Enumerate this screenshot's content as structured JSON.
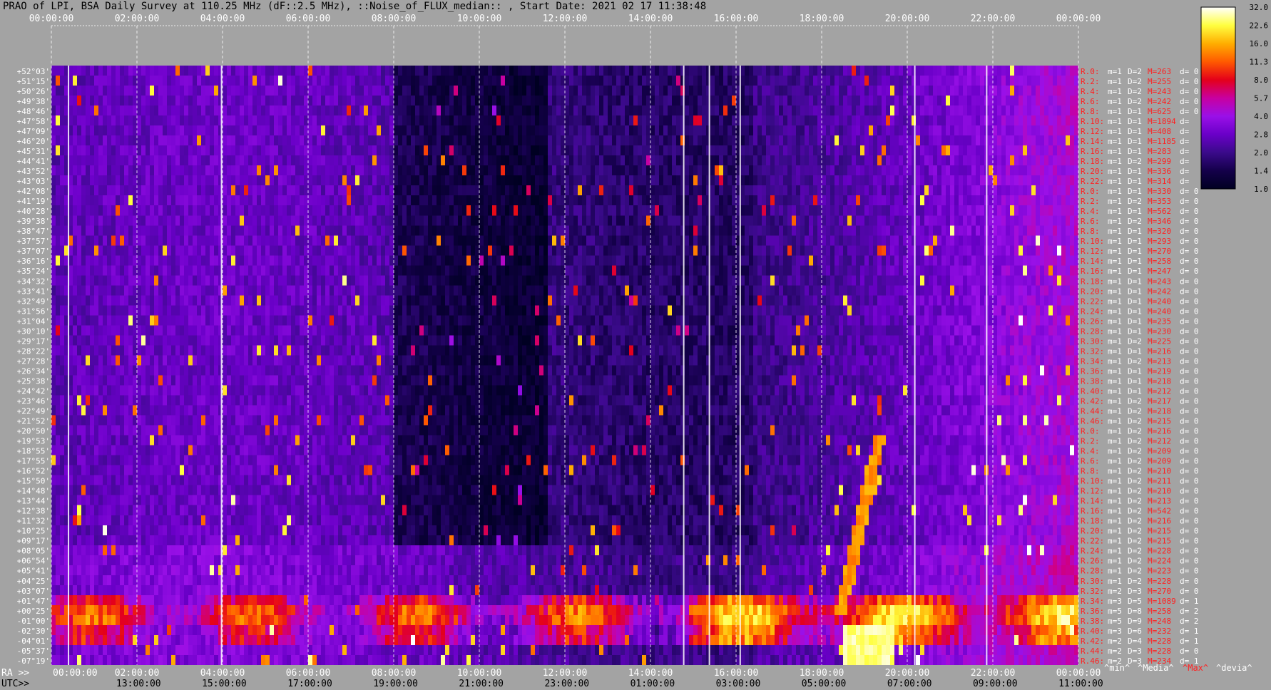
{
  "title": "PRAO of LPI, BSA Daily Survey at 110.25 MHz (dF::2.5 MHz), ::Noise_of_FLUX_median:: , Start Date: 2021 02 17 11:38:48",
  "colors": {
    "background": "#a3a3a3",
    "tick_text": "#ffffff",
    "row_label_text": "#ff2020",
    "colorbar_outline": "#000000"
  },
  "chart_data": {
    "type": "heatmap",
    "x_top_ticks": [
      "00:00:00",
      "02:00:00",
      "04:00:00",
      "06:00:00",
      "08:00:00",
      "10:00:00",
      "12:00:00",
      "14:00:00",
      "16:00:00",
      "18:00:00",
      "20:00:00",
      "22:00:00",
      "00:00:00"
    ],
    "x_bottom_ra_prefix": "RA >>",
    "x_bottom_ra_ticks": [
      "00:00:00",
      "02:00:00",
      "04:00:00",
      "06:00:00",
      "08:00:00",
      "10:00:00",
      "12:00:00",
      "14:00:00",
      "16:00:00",
      "18:00:00",
      "20:00:00",
      "22:00:00",
      "00:00:00"
    ],
    "x_bottom_utc_prefix": "UTC>>",
    "x_bottom_utc_ticks": [
      "13:00:00",
      "15:00:00",
      "17:00:00",
      "19:00:00",
      "21:00:00",
      "23:00:00",
      "01:00:00",
      "03:00:00",
      "05:00:00",
      "07:00:00",
      "09:00:00",
      "11:00:00"
    ],
    "y_declinations": [
      "+52°03'",
      "+51°15'",
      "+50°26'",
      "+49°38'",
      "+48°46'",
      "+47°58'",
      "+47°09'",
      "+46°20'",
      "+45°31'",
      "+44°41'",
      "+43°52'",
      "+43°03'",
      "+42°08'",
      "+41°19'",
      "+40°28'",
      "+39°38'",
      "+38°47'",
      "+37°57'",
      "+37°07'",
      "+36°16'",
      "+35°24'",
      "+34°32'",
      "+33°41'",
      "+32°49'",
      "+31°56'",
      "+31°04'",
      "+30°10'",
      "+29°17'",
      "+28°22'",
      "+27°28'",
      "+26°34'",
      "+25°38'",
      "+24°42'",
      "+23°46'",
      "+22°49'",
      "+21°52'",
      "+20°50'",
      "+19°53'",
      "+18°55'",
      "+17°55'",
      "+16°52'",
      "+15°50'",
      "+14°48'",
      "+13°44'",
      "+12°38'",
      "+11°32'",
      "+10°25'",
      "+09°17'",
      "+08°05'",
      "+06°54'",
      "+05°41'",
      "+04°25'",
      "+03°07'",
      "+01°47'",
      "+00°25'",
      "-01°00'",
      "-02°30'",
      "-04°01'",
      "-05°37'",
      "-07°19'"
    ],
    "beam_stats": [
      [
        "R.0:",
        "m=1",
        "D=2",
        "M=263",
        "d= 0"
      ],
      [
        "R.2:",
        "m=1",
        "D=2",
        "M=255",
        "d= 0"
      ],
      [
        "R.4:",
        "m=1",
        "D=2",
        "M=243",
        "d= 0"
      ],
      [
        "R.6:",
        "m=1",
        "D=2",
        "M=242",
        "d= 0"
      ],
      [
        "R.8:",
        "m=1",
        "D=1",
        "M=625",
        "d= 0"
      ],
      [
        "R.10:",
        "m=1",
        "D=1",
        "M=1894",
        "d="
      ],
      [
        "R.12:",
        "m=1",
        "D=1",
        "M=408",
        "d="
      ],
      [
        "R.14:",
        "m=1",
        "D=1",
        "M=1185",
        "d="
      ],
      [
        "R.16:",
        "m=1",
        "D=1",
        "M=283",
        "d="
      ],
      [
        "R.18:",
        "m=1",
        "D=2",
        "M=299",
        "d="
      ],
      [
        "R.20:",
        "m=1",
        "D=1",
        "M=336",
        "d="
      ],
      [
        "R.22:",
        "m=1",
        "D=1",
        "M=314",
        "d="
      ],
      [
        "R.0:",
        "m=1",
        "D=1",
        "M=330",
        "d= 0"
      ],
      [
        "R.2:",
        "m=1",
        "D=2",
        "M=353",
        "d= 0"
      ],
      [
        "R.4:",
        "m=1",
        "D=1",
        "M=562",
        "d= 0"
      ],
      [
        "R.6:",
        "m=1",
        "D=2",
        "M=346",
        "d= 0"
      ],
      [
        "R.8:",
        "m=1",
        "D=1",
        "M=320",
        "d= 0"
      ],
      [
        "R.10:",
        "m=1",
        "D=1",
        "M=293",
        "d= 0"
      ],
      [
        "R.12:",
        "m=1",
        "D=1",
        "M=270",
        "d= 0"
      ],
      [
        "R.14:",
        "m=1",
        "D=1",
        "M=258",
        "d= 0"
      ],
      [
        "R.16:",
        "m=1",
        "D=1",
        "M=247",
        "d= 0"
      ],
      [
        "R.18:",
        "m=1",
        "D=1",
        "M=243",
        "d= 0"
      ],
      [
        "R.20:",
        "m=1",
        "D=1",
        "M=242",
        "d= 0"
      ],
      [
        "R.22:",
        "m=1",
        "D=1",
        "M=240",
        "d= 0"
      ],
      [
        "R.24:",
        "m=1",
        "D=1",
        "M=240",
        "d= 0"
      ],
      [
        "R.26:",
        "m=1",
        "D=1",
        "M=235",
        "d= 0"
      ],
      [
        "R.28:",
        "m=1",
        "D=1",
        "M=230",
        "d= 0"
      ],
      [
        "R.30:",
        "m=1",
        "D=2",
        "M=225",
        "d= 0"
      ],
      [
        "R.32:",
        "m=1",
        "D=1",
        "M=216",
        "d= 0"
      ],
      [
        "R.34:",
        "m=1",
        "D=2",
        "M=213",
        "d= 0"
      ],
      [
        "R.36:",
        "m=1",
        "D=1",
        "M=219",
        "d= 0"
      ],
      [
        "R.38:",
        "m=1",
        "D=1",
        "M=218",
        "d= 0"
      ],
      [
        "R.40:",
        "m=1",
        "D=1",
        "M=212",
        "d= 0"
      ],
      [
        "R.42:",
        "m=1",
        "D=2",
        "M=217",
        "d= 0"
      ],
      [
        "R.44:",
        "m=1",
        "D=2",
        "M=218",
        "d= 0"
      ],
      [
        "R.46:",
        "m=1",
        "D=2",
        "M=215",
        "d= 0"
      ],
      [
        "R.0:",
        "m=1",
        "D=2",
        "M=216",
        "d= 0"
      ],
      [
        "R.2:",
        "m=1",
        "D=2",
        "M=212",
        "d= 0"
      ],
      [
        "R.4:",
        "m=1",
        "D=2",
        "M=209",
        "d= 0"
      ],
      [
        "R.6:",
        "m=1",
        "D=2",
        "M=209",
        "d= 0"
      ],
      [
        "R.8:",
        "m=1",
        "D=2",
        "M=210",
        "d= 0"
      ],
      [
        "R.10:",
        "m=1",
        "D=2",
        "M=211",
        "d= 0"
      ],
      [
        "R.12:",
        "m=1",
        "D=2",
        "M=210",
        "d= 0"
      ],
      [
        "R.14:",
        "m=1",
        "D=2",
        "M=213",
        "d= 0"
      ],
      [
        "R.16:",
        "m=1",
        "D=2",
        "M=542",
        "d= 0"
      ],
      [
        "R.18:",
        "m=1",
        "D=2",
        "M=216",
        "d= 0"
      ],
      [
        "R.20:",
        "m=1",
        "D=2",
        "M=215",
        "d= 0"
      ],
      [
        "R.22:",
        "m=1",
        "D=2",
        "M=215",
        "d= 0"
      ],
      [
        "R.24:",
        "m=1",
        "D=2",
        "M=228",
        "d= 0"
      ],
      [
        "R.26:",
        "m=1",
        "D=2",
        "M=224",
        "d= 0"
      ],
      [
        "R.28:",
        "m=1",
        "D=2",
        "M=223",
        "d= 0"
      ],
      [
        "R.30:",
        "m=1",
        "D=2",
        "M=228",
        "d= 0"
      ],
      [
        "R.32:",
        "m=2",
        "D=3",
        "M=270",
        "d= 0"
      ],
      [
        "R.34:",
        "m=3",
        "D=5",
        "M=1089",
        "d= 1"
      ],
      [
        "R.36:",
        "m=5",
        "D=8",
        "M=258",
        "d= 2"
      ],
      [
        "R.38:",
        "m=5",
        "D=9",
        "M=248",
        "d= 2"
      ],
      [
        "R.40:",
        "m=3",
        "D=6",
        "M=232",
        "d= 1"
      ],
      [
        "R.42:",
        "m=2",
        "D=4",
        "M=228",
        "d= 1"
      ],
      [
        "R.44:",
        "m=2",
        "D=3",
        "M=228",
        "d= 0"
      ],
      [
        "R.46:",
        "m=2",
        "D=3",
        "M=234",
        "d= 1"
      ]
    ],
    "footer_legend": [
      "^min^",
      "^Media^",
      "^Max^",
      "^devia^"
    ],
    "footer_legend_colors": [
      "#ffffff",
      "#ffffff",
      "#ff2020",
      "#ffffff"
    ],
    "colorbar_ticks": [
      "32.0",
      "22.6",
      "16.0",
      "11.3",
      "8.0",
      "5.7",
      "4.0",
      "2.8",
      "2.0",
      "1.4",
      "1.0"
    ],
    "colormap": [
      "#000022",
      "#14004a",
      "#3a0a8a",
      "#6a00c8",
      "#9a10e8",
      "#c800a0",
      "#e4001a",
      "#ff5a00",
      "#ffae00",
      "#ffff40",
      "#ffffff"
    ],
    "bright_band_declinations": [
      "+00°25'",
      "-01°00'",
      "-02°30'"
    ],
    "source_track": {
      "from_utc": "06:30:00",
      "to_utc": "07:35:00"
    }
  }
}
